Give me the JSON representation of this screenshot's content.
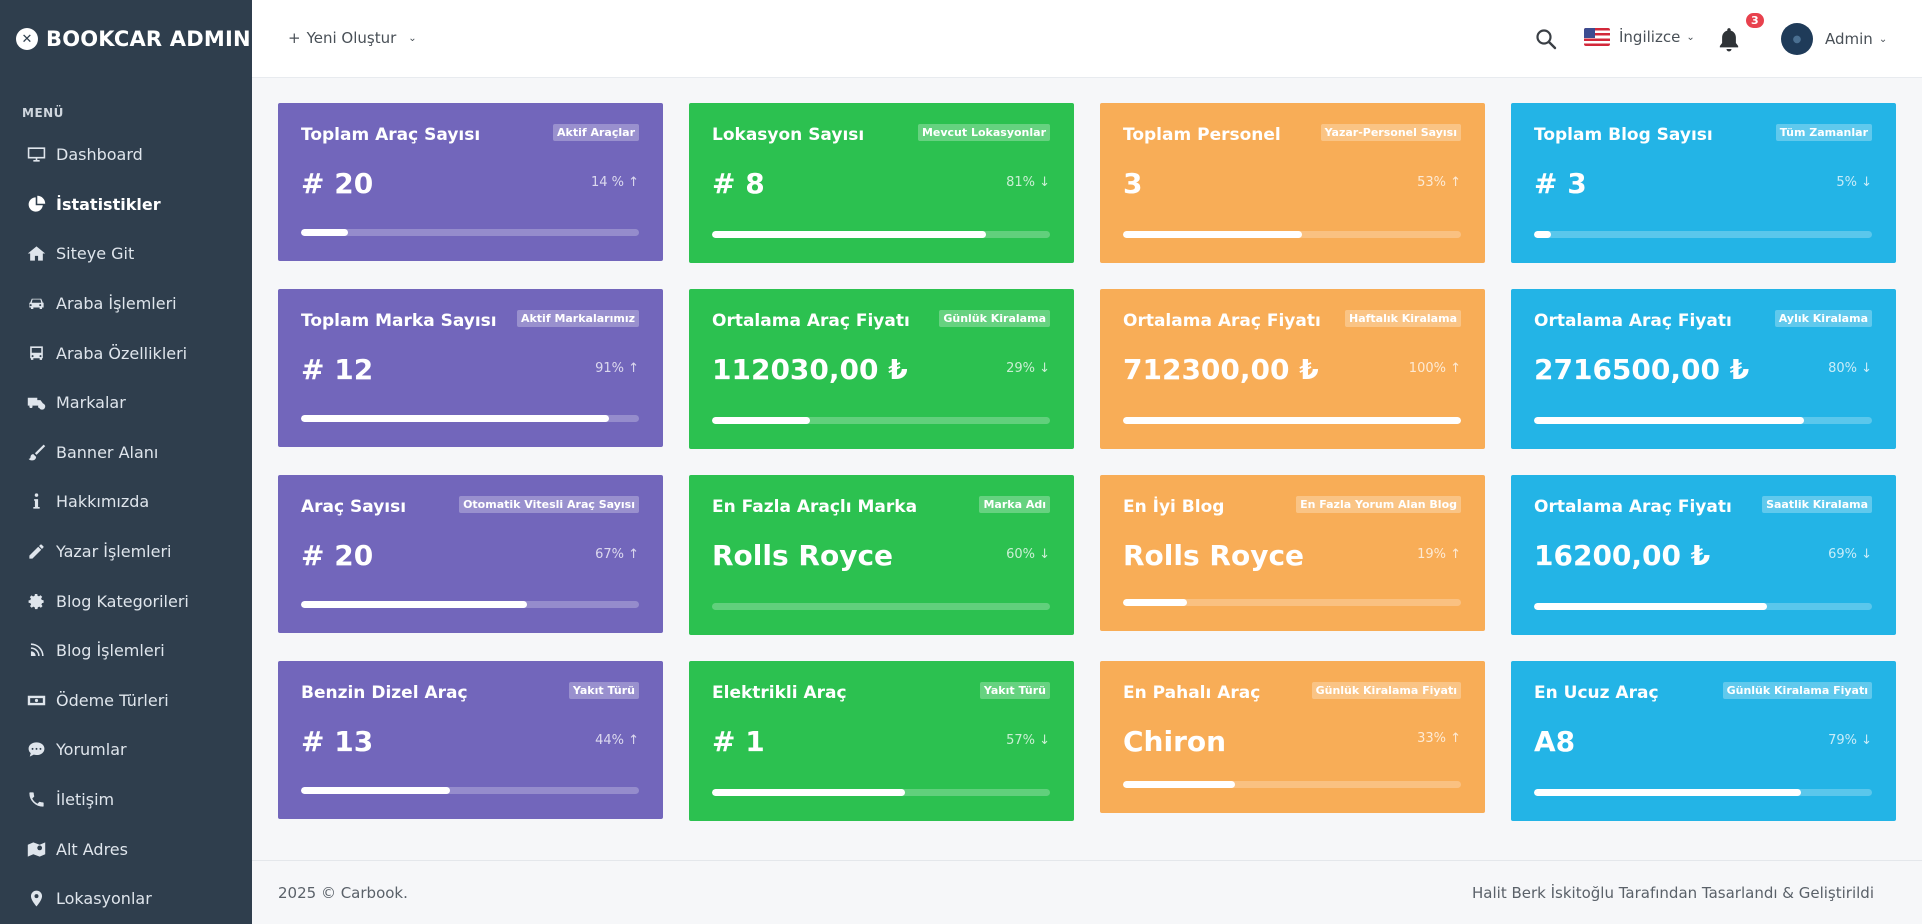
{
  "app": {
    "brand": "BOOKCAR ADMIN"
  },
  "sidebar": {
    "menu_title": "MENÜ",
    "items": [
      {
        "label": "Dashboard",
        "icon": "monitor-icon"
      },
      {
        "label": "İstatistikler",
        "icon": "pie-chart-icon",
        "active": true
      },
      {
        "label": "Siteye Git",
        "icon": "home-icon"
      },
      {
        "label": "Araba İşlemleri",
        "icon": "car-icon"
      },
      {
        "label": "Araba Özellikleri",
        "icon": "bus-icon"
      },
      {
        "label": "Markalar",
        "icon": "truck-clock-icon"
      },
      {
        "label": "Banner Alanı",
        "icon": "paint-brush-icon"
      },
      {
        "label": "Hakkımızda",
        "icon": "info-icon"
      },
      {
        "label": "Yazar İşlemleri",
        "icon": "pencil-icon"
      },
      {
        "label": "Blog Kategorileri",
        "icon": "gear-icon"
      },
      {
        "label": "Blog İşlemleri",
        "icon": "blog-icon"
      },
      {
        "label": "Ödeme Türleri",
        "icon": "money-icon"
      },
      {
        "label": "Yorumlar",
        "icon": "comment-icon"
      },
      {
        "label": "İletişim",
        "icon": "phone-icon"
      },
      {
        "label": "Alt Adres",
        "icon": "map-icon"
      },
      {
        "label": "Lokasyonlar",
        "icon": "location-pin-icon"
      }
    ]
  },
  "topbar": {
    "create_label": "Yeni Oluştur",
    "language": "İngilizce",
    "notification_count": "3",
    "user_name": "Admin"
  },
  "cards": [
    {
      "title": "Toplam Araç Sayısı",
      "tag": "Aktif Araçlar",
      "value": "# 20",
      "pct": "14 %",
      "dir": "up",
      "progress": 0.14,
      "color": "purple"
    },
    {
      "title": "Lokasyon Sayısı",
      "tag": "Mevcut Lokasyonlar",
      "value": "# 8",
      "pct": "81%",
      "dir": "down",
      "progress": 0.81,
      "color": "green"
    },
    {
      "title": "Toplam Personel",
      "tag": "Yazar-Personel Sayısı",
      "value": "3",
      "pct": "53%",
      "dir": "up",
      "progress": 0.53,
      "color": "orange"
    },
    {
      "title": "Toplam Blog Sayısı",
      "tag": "Tüm Zamanlar",
      "value": "# 3",
      "pct": "5%",
      "dir": "down",
      "progress": 0.05,
      "color": "blue"
    },
    {
      "title": "Toplam Marka Sayısı",
      "tag": "Aktif Markalarımız",
      "value": "# 12",
      "pct": "91%",
      "dir": "up",
      "progress": 0.91,
      "color": "purple"
    },
    {
      "title": "Ortalama Araç Fiyatı",
      "tag": "Günlük Kiralama",
      "value": "112030,00 ₺",
      "pct": "29%",
      "dir": "down",
      "progress": 0.29,
      "color": "green"
    },
    {
      "title": "Ortalama Araç Fiyatı",
      "tag": "Haftalık Kiralama",
      "value": "712300,00 ₺",
      "pct": "100%",
      "dir": "up",
      "progress": 1.0,
      "color": "orange"
    },
    {
      "title": "Ortalama Araç Fiyatı",
      "tag": "Aylık Kiralama",
      "value": "2716500,00 ₺",
      "pct": "80%",
      "dir": "down",
      "progress": 0.8,
      "color": "blue"
    },
    {
      "title": "Araç Sayısı",
      "tag": "Otomatik Vitesli Araç Sayısı",
      "value": "# 20",
      "pct": "67%",
      "dir": "up",
      "progress": 0.67,
      "color": "purple"
    },
    {
      "title": "En Fazla Araçlı Marka",
      "tag": "Marka Adı",
      "value": "Rolls Royce",
      "pct": "60%",
      "dir": "down",
      "progress": 0.0,
      "color": "green"
    },
    {
      "title": "En İyi Blog",
      "tag": "En Fazla Yorum Alan Blog",
      "value": "Rolls Royce",
      "pct": "19%",
      "dir": "up",
      "progress": 0.19,
      "color": "orange"
    },
    {
      "title": "Ortalama Araç Fiyatı",
      "tag": "Saatlik Kiralama",
      "value": "16200,00 ₺",
      "pct": "69%",
      "dir": "down",
      "progress": 0.69,
      "color": "blue"
    },
    {
      "title": "Benzin Dizel Araç",
      "tag": "Yakıt Türü",
      "value": "# 13",
      "pct": "44%",
      "dir": "up",
      "progress": 0.44,
      "color": "purple"
    },
    {
      "title": "Elektrikli Araç",
      "tag": "Yakıt Türü",
      "value": "# 1",
      "pct": "57%",
      "dir": "down",
      "progress": 0.57,
      "color": "green"
    },
    {
      "title": "En Pahalı Araç",
      "tag": "Günlük Kiralama Fiyatı",
      "value": "Chiron",
      "pct": "33%",
      "dir": "up",
      "progress": 0.33,
      "color": "orange"
    },
    {
      "title": "En Ucuz Araç",
      "tag": "Günlük Kiralama Fiyatı",
      "value": "A8",
      "pct": "79%",
      "dir": "down",
      "progress": 0.79,
      "color": "blue"
    }
  ],
  "footer": {
    "left": "2025 © Carbook.",
    "right": "Halit Berk İskitoğlu Tarafından Tasarlandı & Geliştirildi"
  }
}
